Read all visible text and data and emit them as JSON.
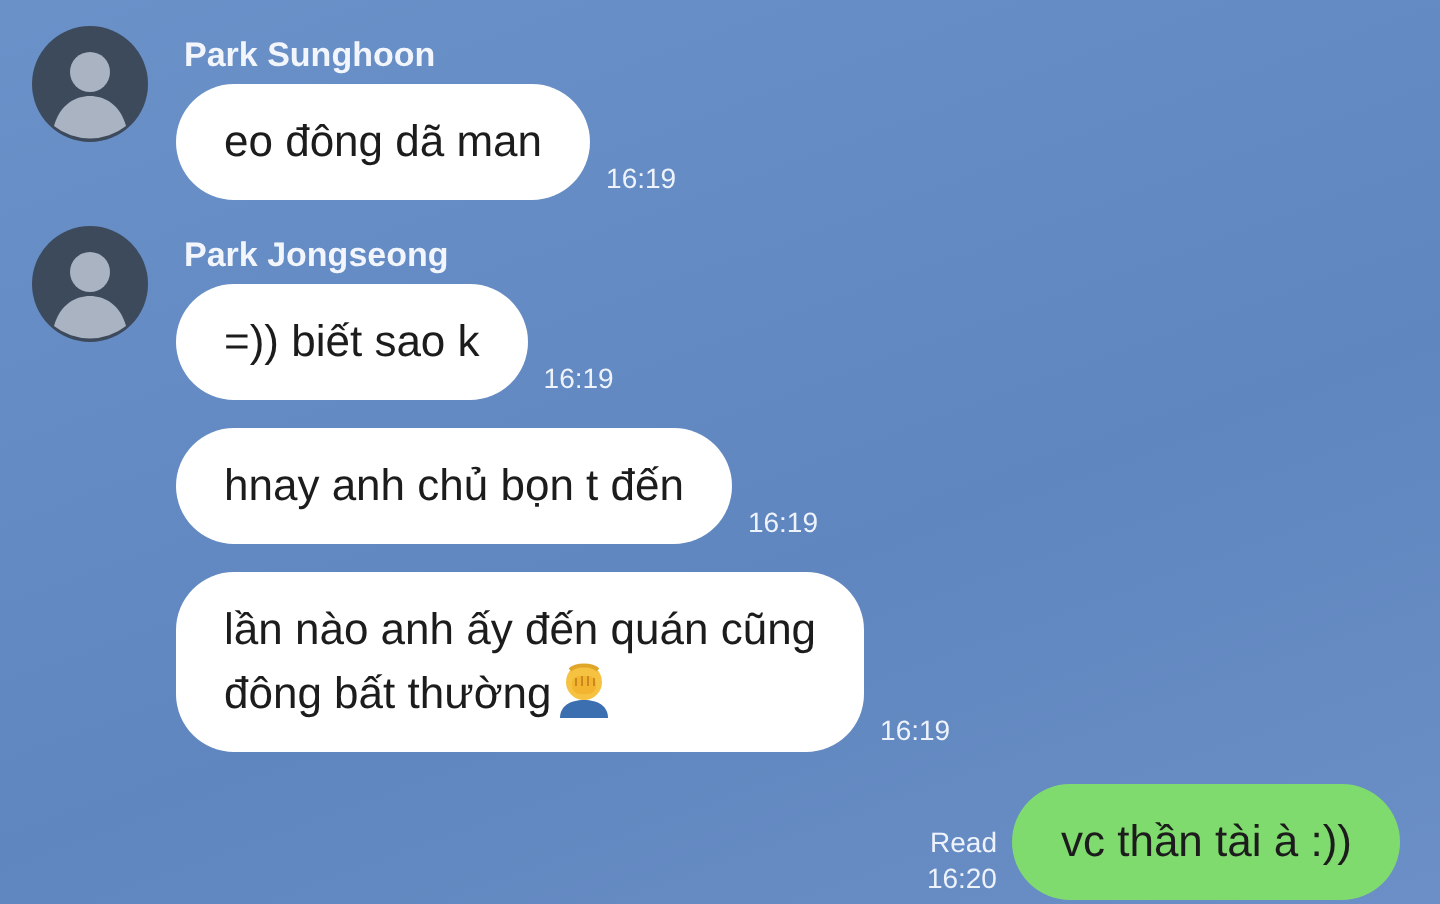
{
  "groups": [
    {
      "sender": "Park Sunghoon",
      "messages": [
        {
          "text": "eo đông dã man",
          "time": "16:19"
        }
      ]
    },
    {
      "sender": "Park Jongseong",
      "messages": [
        {
          "text": "=)) biết sao k",
          "time": "16:19"
        },
        {
          "text": "hnay anh chủ bọn t đến",
          "time": "16:19"
        },
        {
          "text": "lần nào anh ấy đến quán cũng\nđông bất thường",
          "time": "16:19",
          "trailing_icon": true
        }
      ]
    }
  ],
  "outgoing": [
    {
      "text": "vc thần tài à :))",
      "status": "Read",
      "time": "16:20"
    }
  ]
}
